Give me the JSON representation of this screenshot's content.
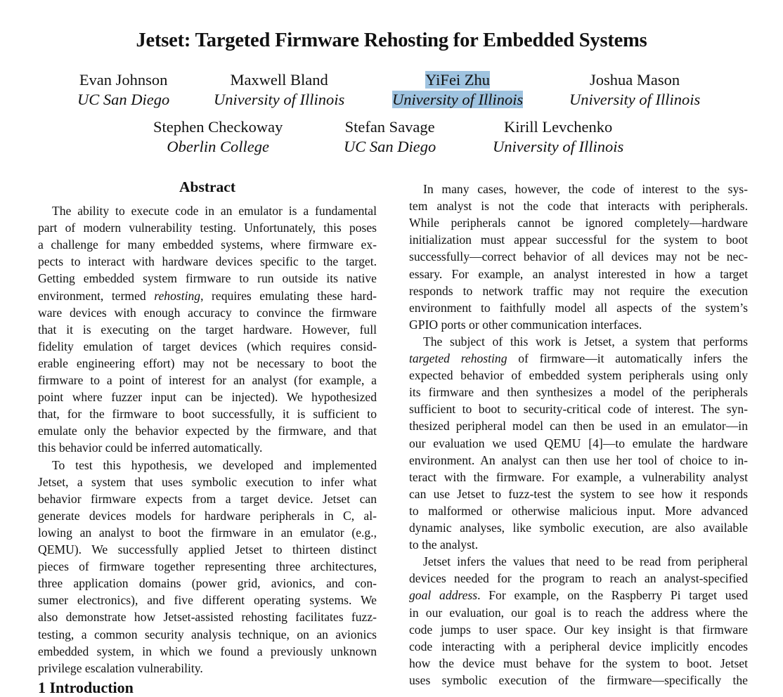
{
  "paper": {
    "title": "Jetset: Targeted Firmware Rehosting for Embedded Systems",
    "authors": [
      {
        "name": "Evan Johnson",
        "affiliation": "UC San Diego",
        "highlighted": false
      },
      {
        "name": "Maxwell Bland",
        "affiliation": "University of Illinois",
        "highlighted": false
      },
      {
        "name": "YiFei Zhu",
        "affiliation": "University of Illinois",
        "highlighted": true
      },
      {
        "name": "Joshua Mason",
        "affiliation": "University of Illinois",
        "highlighted": false
      },
      {
        "name": "Stephen Checkoway",
        "affiliation": "Oberlin College",
        "highlighted": false
      },
      {
        "name": "Stefan Savage",
        "affiliation": "UC San Diego",
        "highlighted": false
      },
      {
        "name": "Kirill Levchenko",
        "affiliation": "University of Illinois",
        "highlighted": false
      }
    ],
    "highlight_color": "#9fc3e0",
    "abstract_heading": "Abstract",
    "section_heading": "1   Introduction",
    "left_lines": [
      "The ability to execute code in an emulator is a fundamental",
      "part of modern vulnerability testing. Unfortunately, this poses",
      "a challenge for many embedded systems, where firmware ex-",
      "pects to interact with hardware devices specific to the target.",
      "Getting embedded system firmware to run outside its native",
      "environment, termed |rehosting|, requires emulating these hard-",
      "ware devices with enough accuracy to convince the firmware",
      "that it is executing on the target hardware.  However, full",
      "fidelity emulation of target devices (which requires consid-",
      "erable engineering effort) may not be necessary to boot the",
      "firmware to a point of interest for an analyst (for example, a",
      "point where fuzzer input can be injected). We hypothesized",
      "that, for the firmware to boot successfully, it is sufficient to",
      "emulate only the behavior expected by the firmware, and that",
      "this behavior could be inferred automatically.",
      "To test this hypothesis, we developed and implemented",
      "Jetset, a system that uses symbolic execution to infer what",
      "behavior firmware expects from a target device.  Jetset can",
      "generate devices models for hardware peripherals in C, al-",
      "lowing an analyst to boot the firmware in an emulator (e.g.,",
      "QEMU). We successfully applied Jetset to thirteen distinct",
      "pieces of firmware together representing three architectures,",
      "three application domains (power grid, avionics, and con-",
      "sumer electronics), and five different operating systems. We",
      "also demonstrate how Jetset-assisted rehosting facilitates fuzz-",
      "testing, a common security analysis technique, on an avionics",
      "embedded system, in which we found a previously unknown",
      "privilege escalation vulnerability."
    ],
    "right_lines": [
      "In many cases, however, the code of interest to the sys-",
      "tem analyst is not the code that interacts with peripherals.",
      "While peripherals cannot be ignored completely—hardware",
      "initialization must appear successful for the system to boot",
      "successfully—correct behavior of all devices may not be nec-",
      "essary.  For example, an analyst interested in how a target",
      "responds to network traffic may not require the execution",
      "environment to faithfully model all aspects of the system’s",
      "GPIO ports or other communication interfaces.",
      "The subject of this work is Jetset, a system that performs",
      "|targeted rehosting| of firmware—it automatically infers the",
      "expected behavior of embedded system peripherals using only",
      "its firmware and then synthesizes a model of the peripherals",
      "sufficient to boot to security-critical code of interest. The syn-",
      "thesized peripheral model can then be used in an emulator—in",
      "our evaluation we used QEMU [4]—to emulate the hardware",
      "environment. An analyst can then use her tool of choice to in-",
      "teract with the firmware. For example, a vulnerability analyst",
      "can use Jetset to fuzz-test the system to see how it responds",
      "to malformed or otherwise malicious input. More advanced",
      "dynamic analyses, like symbolic execution, are also available",
      "to the analyst.",
      "Jetset infers the values that need to be read from peripheral",
      "devices needed for the program to reach an analyst-specified",
      "|goal address|. For example, on the Raspberry Pi target used",
      "in our evaluation, our goal is to reach the address where the",
      "code jumps to user space.  Our key insight is that firmware",
      "code interacting with a peripheral device implicitly encodes",
      "how the device must behave for the system to boot.  Jetset",
      "uses symbolic execution of the firmware—specifically the"
    ]
  }
}
